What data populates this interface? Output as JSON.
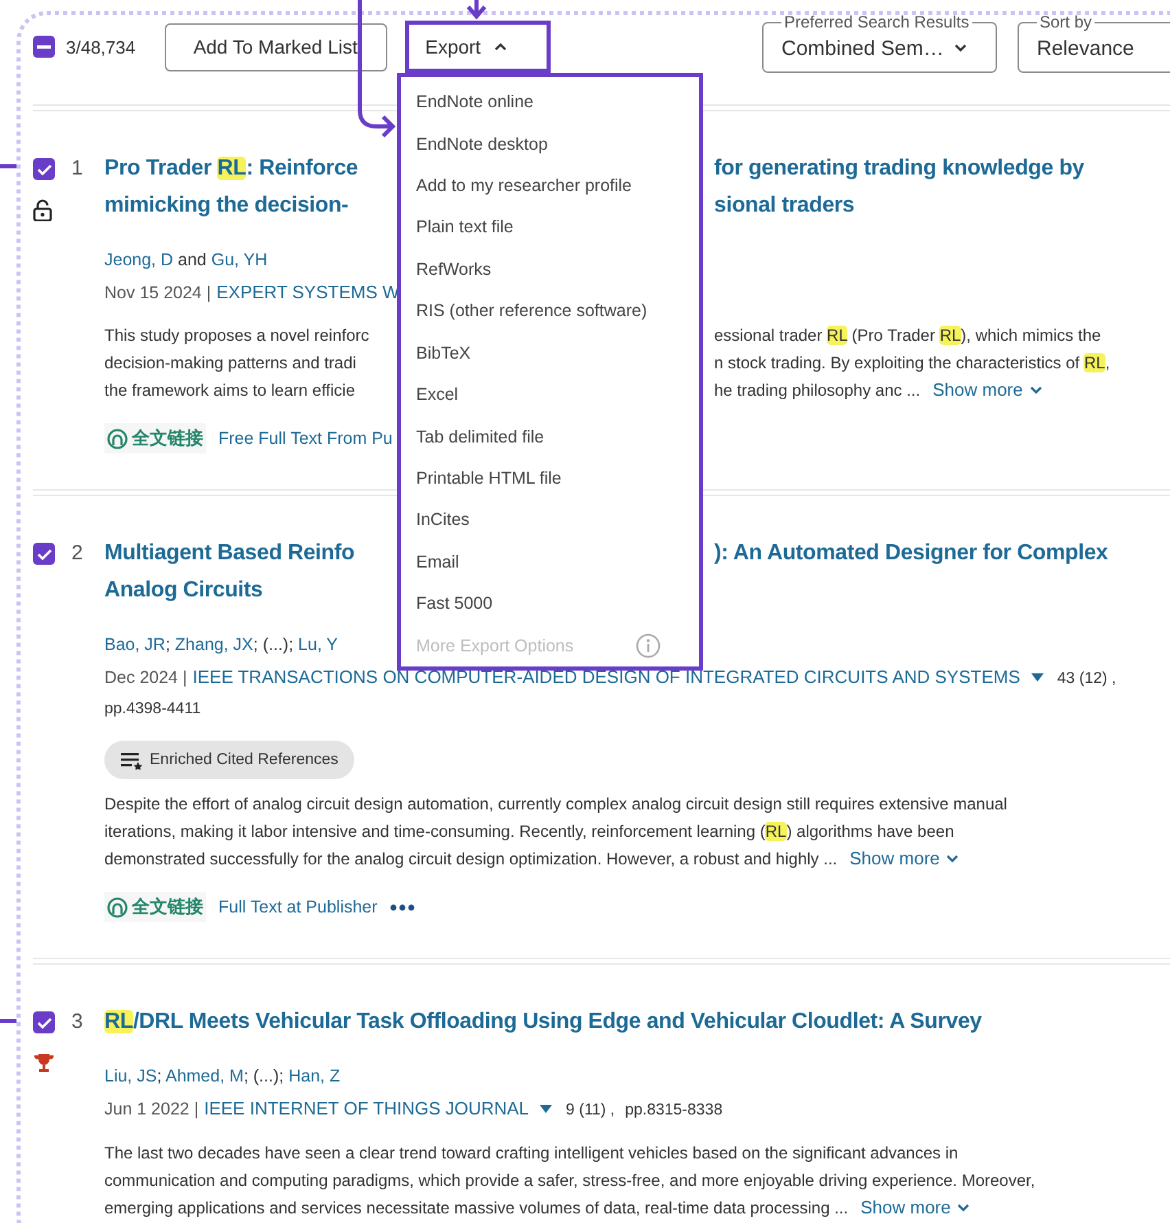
{
  "toolbar": {
    "select_all": {
      "indeterminate": true
    },
    "count": "3/48,734",
    "add_button": "Add To Marked List",
    "export_button": {
      "label": "Export",
      "expanded": true
    },
    "preferred": {
      "label": "Preferred Search Results",
      "value": "Combined Sem…"
    },
    "sort": {
      "label": "Sort by",
      "value": "Relevance"
    }
  },
  "export_menu": [
    {
      "label": "EndNote online",
      "disabled": false,
      "info": false
    },
    {
      "label": "EndNote desktop",
      "disabled": false,
      "info": false
    },
    {
      "label": "Add to my researcher profile",
      "disabled": false,
      "info": false
    },
    {
      "label": "Plain text file",
      "disabled": false,
      "info": false
    },
    {
      "label": "RefWorks",
      "disabled": false,
      "info": false
    },
    {
      "label": "RIS (other reference software)",
      "disabled": false,
      "info": false
    },
    {
      "label": "BibTeX",
      "disabled": false,
      "info": false
    },
    {
      "label": "Excel",
      "disabled": false,
      "info": false
    },
    {
      "label": "Tab delimited file",
      "disabled": false,
      "info": false
    },
    {
      "label": "Printable HTML file",
      "disabled": false,
      "info": false
    },
    {
      "label": "InCites",
      "disabled": false,
      "info": false
    },
    {
      "label": "Email",
      "disabled": false,
      "info": false
    },
    {
      "label": "Fast 5000",
      "disabled": false,
      "info": false
    },
    {
      "label": "More Export Options",
      "disabled": true,
      "info": true
    }
  ],
  "records": [
    {
      "number": "1",
      "checked": true,
      "open_access": true,
      "highly_cited": false,
      "title": [
        {
          "left": [
            {
              "text": "Pro Trader ",
              "highlight": false
            },
            {
              "text": "RL",
              "highlight": true
            },
            {
              "text": ": Reinforce",
              "highlight": false
            }
          ],
          "right": [
            {
              "text": "for generating trading knowledge by",
              "highlight": false
            }
          ]
        },
        {
          "left": [
            {
              "text": "mimicking the decision-",
              "highlight": false
            }
          ],
          "right": [
            {
              "text": "sional traders",
              "highlight": false
            }
          ]
        }
      ],
      "authors": [
        {
          "text": "Jeong, D",
          "link": true
        },
        {
          "text": " and ",
          "link": false
        },
        {
          "text": "Gu, YH",
          "link": true
        }
      ],
      "date": "Nov 15 2024 |",
      "journal": "EXPERT SYSTEMS W",
      "journal_menu": false,
      "abstract": [
        {
          "left": [
            {
              "text": "This study proposes a novel reinforc",
              "highlight": false
            }
          ],
          "right": [
            {
              "text": "essional trader ",
              "highlight": false
            },
            {
              "text": "RL",
              "highlight": true
            },
            {
              "text": " (Pro Trader ",
              "highlight": false
            },
            {
              "text": "RL",
              "highlight": true
            },
            {
              "text": "), which mimics the",
              "highlight": false
            }
          ]
        },
        {
          "left": [
            {
              "text": "decision-making patterns and tradi",
              "highlight": false
            }
          ],
          "right": [
            {
              "text": "n stock trading. By exploiting the characteristics of ",
              "highlight": false
            },
            {
              "text": "RL",
              "highlight": true
            },
            {
              "text": ",",
              "highlight": false
            }
          ]
        },
        {
          "left": [
            {
              "text": "the framework aims to learn efficie",
              "highlight": false
            }
          ],
          "right": [
            {
              "text": "he trading philosophy anc ...",
              "highlight": false
            }
          ]
        }
      ],
      "show_more": "Show more",
      "full_text": "全文链接",
      "publisher_link": "Free Full Text From Pu",
      "more_menu": false
    },
    {
      "number": "2",
      "checked": true,
      "open_access": false,
      "highly_cited": false,
      "title": [
        {
          "left": [
            {
              "text": "Multiagent Based Reinfo",
              "highlight": false
            }
          ],
          "right": [
            {
              "text": "): An Automated Designer for Complex",
              "highlight": false
            }
          ]
        },
        {
          "left": [
            {
              "text": "Analog Circuits",
              "highlight": false
            }
          ]
        }
      ],
      "authors": [
        {
          "text": "Bao, JR",
          "link": true
        },
        {
          "text": "; ",
          "link": false
        },
        {
          "text": "Zhang, JX",
          "link": true
        },
        {
          "text": "; (...); ",
          "link": false
        },
        {
          "text": "Lu, Y",
          "link": true
        }
      ],
      "date": "Dec 2024 |",
      "journal": "IEEE TRANSACTIONS ON COMPUTER-AIDED DESIGN OF INTEGRATED CIRCUITS AND SYSTEMS",
      "journal_menu": true,
      "volume": "43 (12) ,",
      "pages": "pp.4398-4411",
      "enriched": "Enriched Cited References",
      "abstract": [
        {
          "left": [
            {
              "text": "Despite the effort of analog circuit design automation, currently complex analog circuit design still requires extensive manual",
              "highlight": false
            }
          ]
        },
        {
          "left": [
            {
              "text": "iterations, making it labor intensive and time-consuming. Recently, reinforcement learning (",
              "highlight": false
            },
            {
              "text": "RL",
              "highlight": true
            },
            {
              "text": ") algorithms have been",
              "highlight": false
            }
          ]
        },
        {
          "left": [
            {
              "text": "demonstrated successfully for the analog circuit design optimization. However, a robust and highly  ...",
              "highlight": false
            }
          ]
        }
      ],
      "show_more": "Show more",
      "full_text": "全文链接",
      "publisher_link": "Full Text at Publisher",
      "more_menu": true
    },
    {
      "number": "3",
      "checked": true,
      "open_access": false,
      "highly_cited": true,
      "title": [
        {
          "left": [
            {
              "text": "RL",
              "highlight": true
            },
            {
              "text": "/DRL Meets Vehicular Task Offloading Using Edge and Vehicular Cloudlet: A Survey",
              "highlight": false
            }
          ]
        }
      ],
      "authors": [
        {
          "text": "Liu, JS",
          "link": true
        },
        {
          "text": "; ",
          "link": false
        },
        {
          "text": "Ahmed, M",
          "link": true
        },
        {
          "text": "; (...); ",
          "link": false
        },
        {
          "text": "Han, Z",
          "link": true
        }
      ],
      "date": "Jun 1 2022 |",
      "journal": "IEEE INTERNET OF THINGS JOURNAL",
      "journal_menu": true,
      "volume": "9 (11) ,",
      "pages": "pp.8315-8338",
      "abstract": [
        {
          "left": [
            {
              "text": "The last two decades have seen a clear trend toward crafting intelligent vehicles based on the significant advances in",
              "highlight": false
            }
          ]
        },
        {
          "left": [
            {
              "text": "communication and computing paradigms, which provide a safer, stress-free, and more enjoyable driving experience. Moreover,",
              "highlight": false
            }
          ]
        },
        {
          "left": [
            {
              "text": "emerging applications and services necessitate massive volumes of data, real-time data processing ...",
              "highlight": false
            }
          ]
        }
      ],
      "show_more": "Show more"
    }
  ]
}
